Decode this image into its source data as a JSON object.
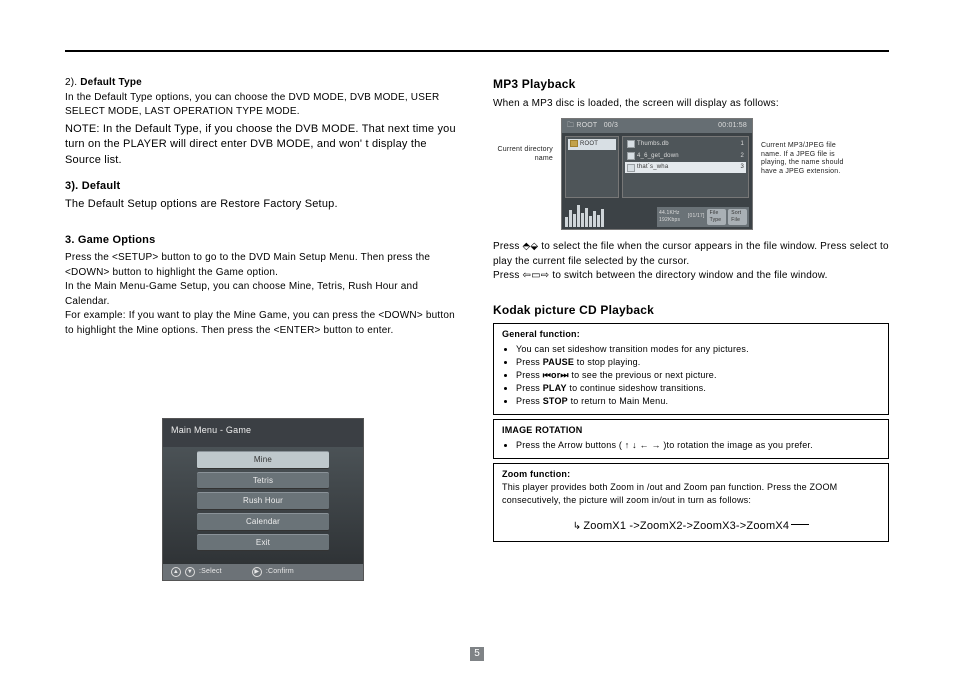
{
  "page_number": "5",
  "left": {
    "sec2_num": "2).",
    "sec2_title": "Default Type",
    "sec2_body": "In the Default Type options, you can choose the DVD MODE, DVB MODE, USER SELECT MODE, LAST OPERATION TYPE MODE.",
    "sec2_note": "NOTE: In the Default Type, if you choose the DVB MODE. That next time you turn on the PLAYER will direct enter DVB MODE, and won' t display the Source list.",
    "sec3_title": "3). Default",
    "sec3_body": "The Default Setup options are Restore Factory Setup.",
    "game_title": "3. Game Options",
    "game_p1": "Press the <SETUP> button to go to the DVD Main Setup Menu. Then press the <DOWN> button to highlight the Game option.",
    "game_p2": "In the Main Menu-Game Setup, you can choose Mine, Tetris, Rush Hour and Calendar.",
    "game_p3": "For example: If you want to play the Mine Game, you can press the <DOWN> button to highlight the Mine options. Then press the <ENTER> button to enter.",
    "game_menu": {
      "title": "Main Menu - Game",
      "items": [
        "Mine",
        "Tetris",
        "Rush Hour",
        "Calendar",
        "Exit"
      ],
      "footer_select": ":Select",
      "footer_confirm": ":Confirm"
    }
  },
  "right": {
    "mp3_title": "MP3 Playback",
    "mp3_intro": "When a MP3 disc is loaded, the screen will display as follows:",
    "mp3_label_left": "Current directory name",
    "mp3_label_right": "Current MP3/JPEG file name. If a JPEG file is playing, the name should have a JPEG extension.",
    "mp3_player": {
      "top_left": "ROOT",
      "top_mid": "00/3",
      "top_right": "00:01:58",
      "dir": "ROOT",
      "files": [
        {
          "name": "Thumbs.db",
          "num": "1"
        },
        {
          "name": "4_6_get_down",
          "num": "2"
        },
        {
          "name": "that`s_wha",
          "num": "3"
        }
      ],
      "info_rate": "44.1KHz  192Kbps",
      "info_track": "[01/17]",
      "btn1": "File Type",
      "btn2": "Sort File"
    },
    "mp3_press1a": "Press ",
    "mp3_press1_icon": "⇧⇩",
    "mp3_press1b": " to select the file when the cursor appears in the file window. Press select to play the current file selected by the cursor.",
    "mp3_press2a": "Press ",
    "mp3_press2_icon": "⇦▭⇨",
    "mp3_press2b": " to switch between the directory window and the file window.",
    "kodak_title": "Kodak picture CD Playback",
    "box1": {
      "subtitle": "General function:",
      "li1": "You can set sideshow transition modes for any pictures.",
      "li2a": "Press ",
      "li2b": "PAUSE",
      "li2c": " to stop playing.",
      "li3a": "Press ",
      "li3_icon": "⏮or⏭",
      "li3b": "  to see the previous or next picture.",
      "li4a": "Press ",
      "li4b": "PLAY",
      "li4c": " to continue sideshow transitions.",
      "li5a": "Press ",
      "li5b": "STOP",
      "li5c": " to return to Main Menu."
    },
    "box2": {
      "subtitle": "IMAGE ROTATION",
      "li1a": "Press the Arrow buttons  ( ",
      "li1_icon": "↑  ↓  ←  →",
      "li1b": " )to rotation the image as you prefer."
    },
    "box3": {
      "subtitle": "Zoom function:",
      "body": "This player provides both Zoom in /out and Zoom pan function. Press the ZOOM consecutively, the picture will zoom in/out in turn as follows:",
      "zoom": "ZoomX1 ->ZoomX2->ZoomX3->ZoomX4",
      "lead_arrow": "↳"
    }
  }
}
